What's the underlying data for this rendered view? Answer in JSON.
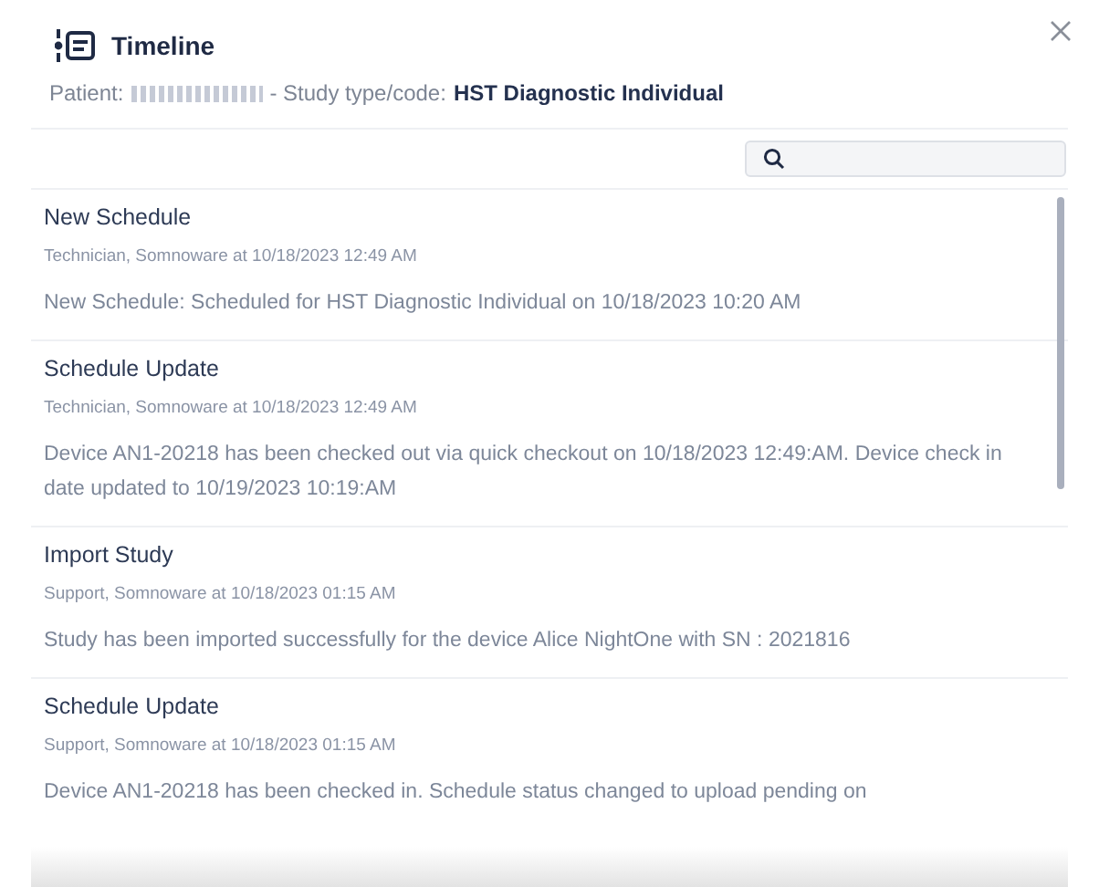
{
  "dialog": {
    "title": "Timeline"
  },
  "subtitle": {
    "patient_label": "Patient:",
    "separator": "- Study type/code:",
    "study_type": "HST Diagnostic Individual"
  },
  "entries": [
    {
      "title": "New Schedule",
      "meta": "Technician, Somnoware at 10/18/2023 12:49 AM",
      "body": "New Schedule: Scheduled for HST Diagnostic Individual on 10/18/2023 10:20 AM"
    },
    {
      "title": "Schedule Update",
      "meta": "Technician, Somnoware at 10/18/2023 12:49 AM",
      "body": "Device AN1-20218 has been checked out via quick checkout on 10/18/2023 12:49:AM. Device check in date updated to 10/19/2023 10:19:AM"
    },
    {
      "title": "Import Study",
      "meta": "Support, Somnoware at 10/18/2023 01:15 AM",
      "body": "Study has been imported successfully for the device Alice NightOne with SN : 2021816"
    },
    {
      "title": "Schedule Update",
      "meta": "Support, Somnoware at 10/18/2023 01:15 AM",
      "body": "Device AN1-20218 has been checked in. Schedule status changed to upload pending on"
    }
  ]
}
